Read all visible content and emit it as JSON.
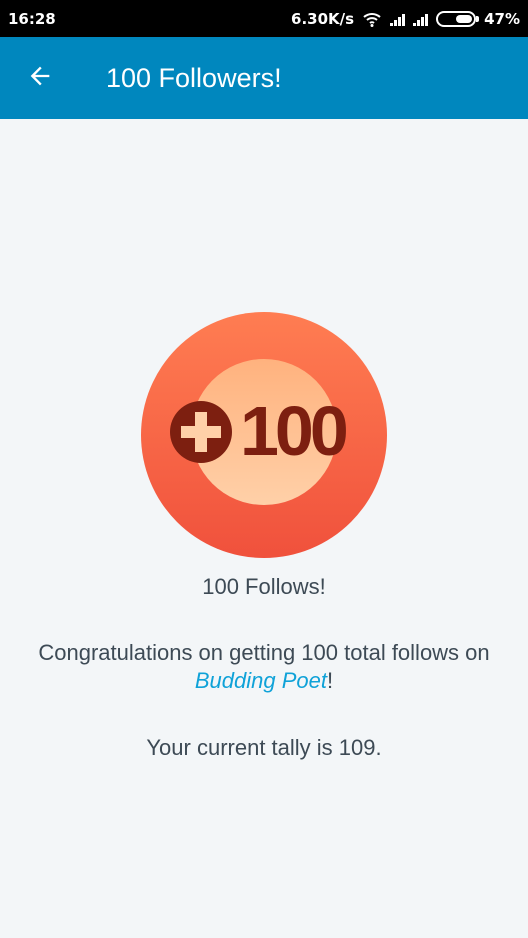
{
  "status_bar": {
    "time": "16:28",
    "network_speed": "6.30K/s",
    "battery_percent": "47%",
    "icons": [
      "wifi-icon",
      "signal-icon",
      "signal-icon",
      "battery-icon"
    ]
  },
  "app_bar": {
    "back_icon": "arrow-left-icon",
    "title": "100 Followers!"
  },
  "badge": {
    "plus_icon": "plus-circle-icon",
    "number": "100",
    "colors": {
      "outer_top": "#ff7d52",
      "outer_bottom": "#f0513c",
      "inner_top": "#ffb27e",
      "inner_bottom": "#ffd0a8",
      "mark": "#7d1f10"
    }
  },
  "content": {
    "caption": "100 Follows!",
    "message_prefix": "Congratulations on getting 100 total follows on ",
    "site_name": "Budding Poet",
    "message_suffix": "!",
    "tally": "Your current tally is 109."
  },
  "colors": {
    "app_bar": "#0087be",
    "background": "#f3f6f8",
    "link": "#0fa2d8",
    "text": "#3d4a55"
  }
}
